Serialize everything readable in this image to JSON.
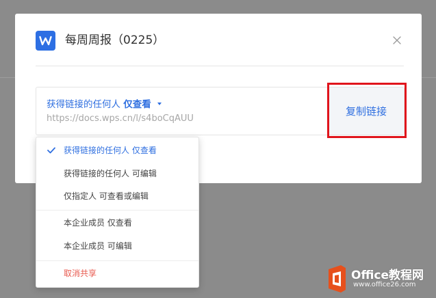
{
  "dialog": {
    "title": "每周周报（0225）",
    "app_icon": "wps-writer-icon",
    "close_icon": "close-icon"
  },
  "share": {
    "permission_prefix": "获得链接的任何人",
    "permission_value": "仅查看",
    "url": "https://docs.wps.cn/l/s4boCqAUU",
    "copy_button": "复制链接"
  },
  "menu": {
    "items": [
      {
        "label": "获得链接的任何人 仅查看",
        "selected": true
      },
      {
        "label": "获得链接的任何人 可编辑"
      },
      {
        "label": "仅指定人 可查看或编辑"
      },
      {
        "label": "本企业成员 仅查看"
      },
      {
        "label": "本企业成员 可编辑"
      },
      {
        "label": "取消共享",
        "danger": true
      }
    ]
  },
  "watermark": {
    "brand_a": "Office",
    "brand_b": "教程网",
    "url": "www.office26.com"
  },
  "colors": {
    "accent": "#2f6fe0",
    "highlight": "#e0141c",
    "danger": "#e85a4f",
    "overlay": "#8b8b8b"
  }
}
